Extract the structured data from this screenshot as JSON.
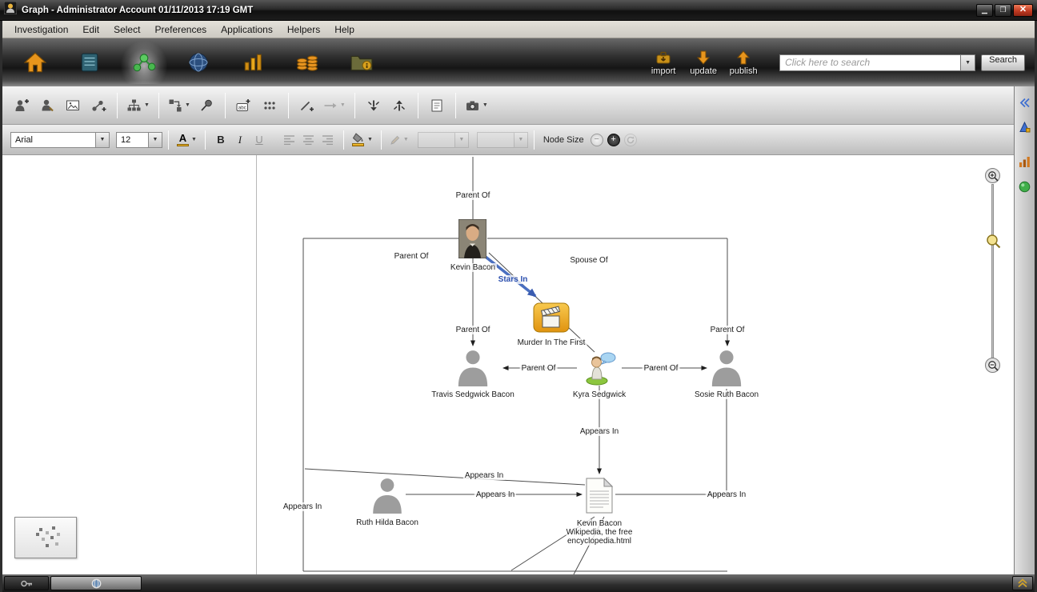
{
  "colors": {
    "accent_orange": "#e8951c",
    "active_green": "#46b24e",
    "stars_in_blue": "#4a6fc0",
    "close_button_red": "#c03a22"
  },
  "titlebar": {
    "title": "Graph - Administrator Account 01/11/2013 17:19 GMT"
  },
  "menubar": {
    "items": [
      "Investigation",
      "Edit",
      "Select",
      "Preferences",
      "Applications",
      "Helpers",
      "Help"
    ]
  },
  "main_toolbar": {
    "import_label": "import",
    "update_label": "update",
    "publish_label": "publish",
    "search": {
      "placeholder": "Click here to search",
      "button_label": "Search"
    }
  },
  "toolbar2": {
    "abc_label": "abc"
  },
  "format_toolbar": {
    "font_family_value": "Arial",
    "font_size_value": "12",
    "text_color_label": "A",
    "bold_label": "B",
    "italic_label": "I",
    "underline_label": "U",
    "node_size_label": "Node Size",
    "minus_label": "−",
    "plus_label": "+"
  },
  "graph": {
    "nodes": {
      "kevin": {
        "label": "Kevin Bacon"
      },
      "movie": {
        "label": "Murder In The First"
      },
      "travis": {
        "label": "Travis Sedgwick Bacon"
      },
      "kyra": {
        "label": "Kyra Sedgwick"
      },
      "sosie": {
        "label": "Sosie Ruth Bacon"
      },
      "ruth": {
        "label": "Ruth Hilda Bacon"
      },
      "document": {
        "label_lines": [
          "Kevin Bacon",
          "Wikipedia, the free",
          "encyclopedia.html"
        ]
      }
    },
    "edge_labels": [
      "Parent Of",
      "Parent Of",
      "Spouse Of",
      "Stars In",
      "Parent Of",
      "Parent Of",
      "Parent Of",
      "Parent Of",
      "Appears In",
      "Appears In",
      "Appears In",
      "Appears In",
      "Appears In"
    ]
  }
}
